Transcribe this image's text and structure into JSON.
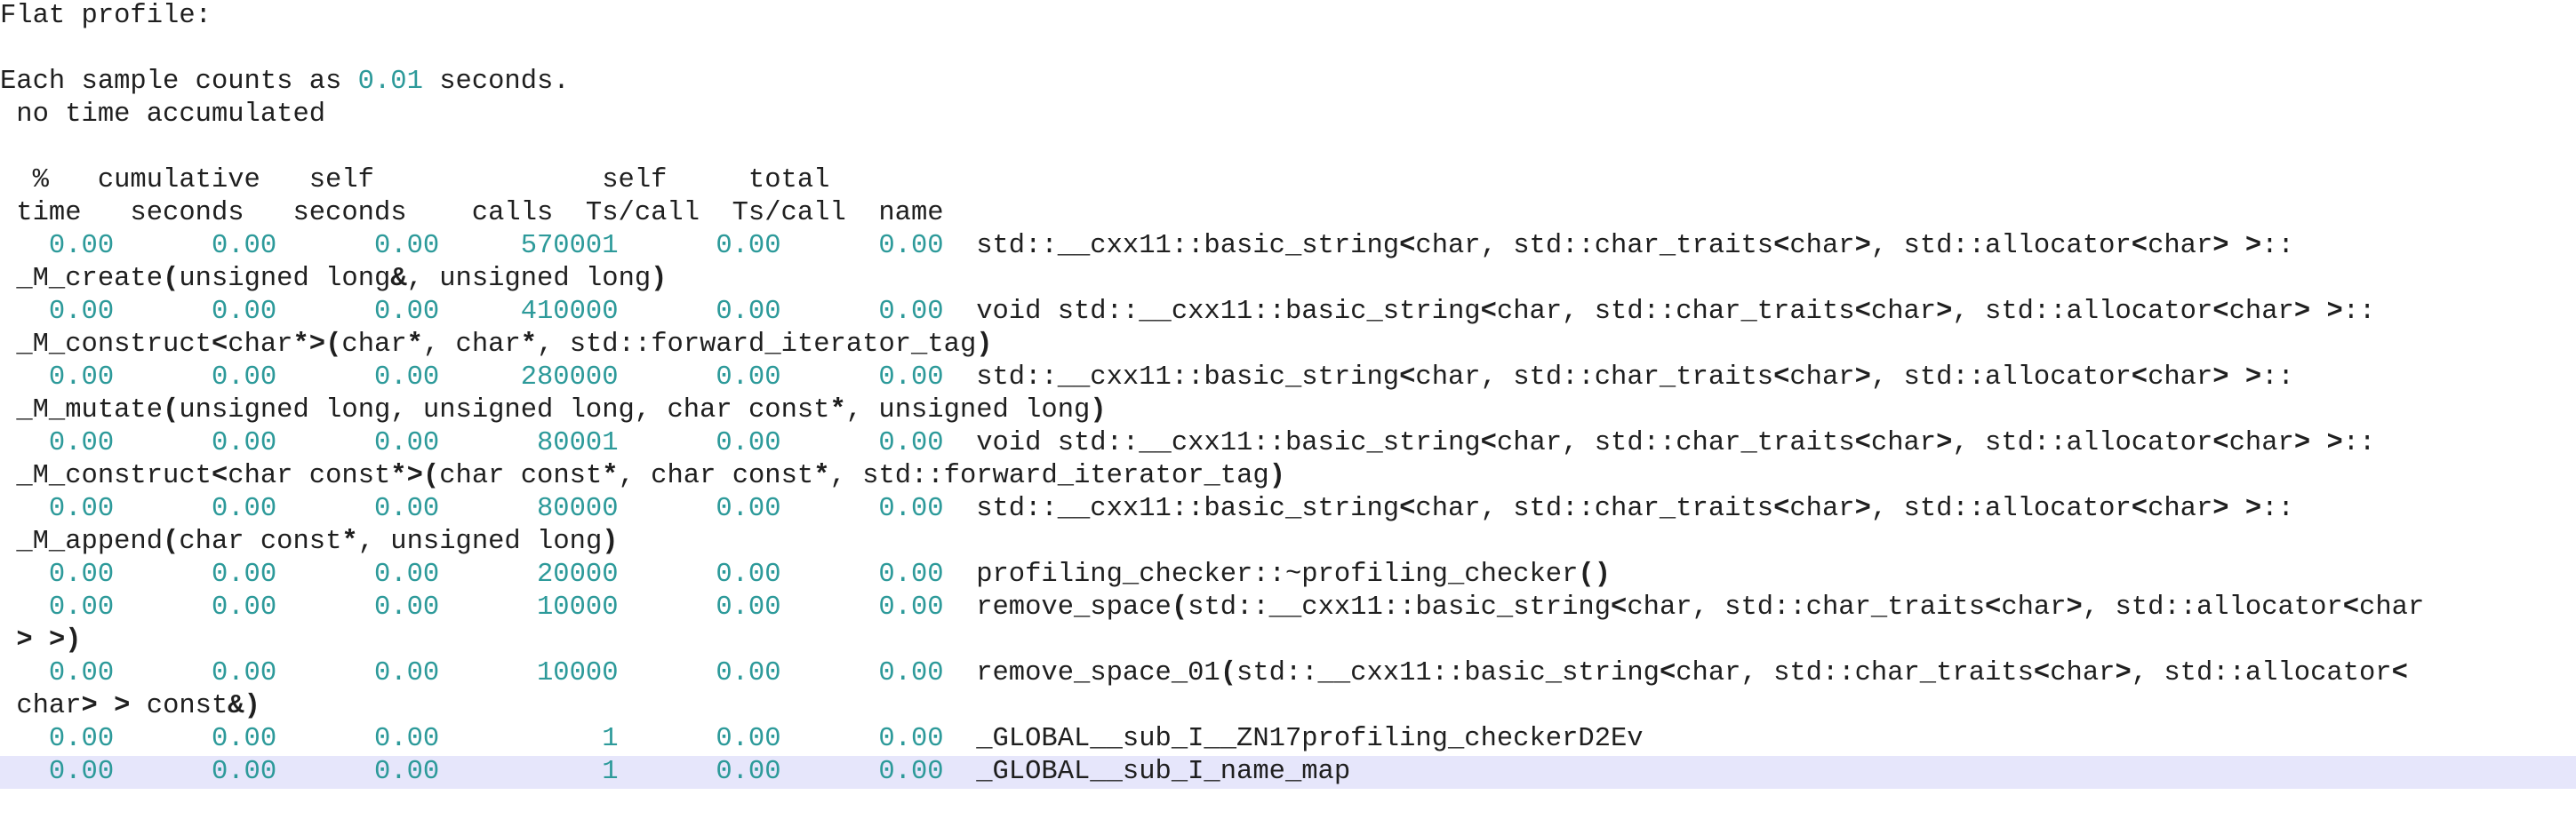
{
  "title": "Flat profile:",
  "sample_prefix": "Each sample counts as ",
  "sample_value": "0.01",
  "sample_suffix": " seconds.",
  "no_time": " no time accumulated",
  "header1": "  %   cumulative   self              self     total           ",
  "header2": " time   seconds   seconds    calls  Ts/call  Ts/call  name    ",
  "colors": {
    "number": "#2d9a9a",
    "text": "#1f1f1f",
    "highlight": "#e6e6fb"
  },
  "rows": [
    {
      "time": "0.00",
      "cumulative": "0.00",
      "self": "0.00",
      "calls": "570001",
      "self_ts": "0.00",
      "total_ts": "0.00",
      "name1": "std::__cxx11::basic_string<char, std::char_traits<char>, std::allocator<char> >::",
      "name2": "_M_create(unsigned long&, unsigned long)"
    },
    {
      "time": "0.00",
      "cumulative": "0.00",
      "self": "0.00",
      "calls": "410000",
      "self_ts": "0.00",
      "total_ts": "0.00",
      "name1": "void std::__cxx11::basic_string<char, std::char_traits<char>, std::allocator<char> >::",
      "name2": "_M_construct<char*>(char*, char*, std::forward_iterator_tag)"
    },
    {
      "time": "0.00",
      "cumulative": "0.00",
      "self": "0.00",
      "calls": "280000",
      "self_ts": "0.00",
      "total_ts": "0.00",
      "name1": "std::__cxx11::basic_string<char, std::char_traits<char>, std::allocator<char> >::",
      "name2": "_M_mutate(unsigned long, unsigned long, char const*, unsigned long)"
    },
    {
      "time": "0.00",
      "cumulative": "0.00",
      "self": "0.00",
      "calls": "80001",
      "self_ts": "0.00",
      "total_ts": "0.00",
      "name1": "void std::__cxx11::basic_string<char, std::char_traits<char>, std::allocator<char> >::",
      "name2": "_M_construct<char const*>(char const*, char const*, std::forward_iterator_tag)"
    },
    {
      "time": "0.00",
      "cumulative": "0.00",
      "self": "0.00",
      "calls": "80000",
      "self_ts": "0.00",
      "total_ts": "0.00",
      "name1": "std::__cxx11::basic_string<char, std::char_traits<char>, std::allocator<char> >::",
      "name2": "_M_append(char const*, unsigned long)"
    },
    {
      "time": "0.00",
      "cumulative": "0.00",
      "self": "0.00",
      "calls": "20000",
      "self_ts": "0.00",
      "total_ts": "0.00",
      "name1": "profiling_checker::~profiling_checker()",
      "name2": ""
    },
    {
      "time": "0.00",
      "cumulative": "0.00",
      "self": "0.00",
      "calls": "10000",
      "self_ts": "0.00",
      "total_ts": "0.00",
      "name1": "remove_space(std::__cxx11::basic_string<char, std::char_traits<char>, std::allocator<char",
      "name2": "> >)"
    },
    {
      "time": "0.00",
      "cumulative": "0.00",
      "self": "0.00",
      "calls": "10000",
      "self_ts": "0.00",
      "total_ts": "0.00",
      "name1": "remove_space_01(std::__cxx11::basic_string<char, std::char_traits<char>, std::allocator<",
      "name2": "char> > const&)"
    },
    {
      "time": "0.00",
      "cumulative": "0.00",
      "self": "0.00",
      "calls": "1",
      "self_ts": "0.00",
      "total_ts": "0.00",
      "name1": "_GLOBAL__sub_I__ZN17profiling_checkerD2Ev",
      "name2": ""
    },
    {
      "time": "0.00",
      "cumulative": "0.00",
      "self": "0.00",
      "calls": "1",
      "self_ts": "0.00",
      "total_ts": "0.00",
      "name1": "_GLOBAL__sub_I_name_map",
      "name2": ""
    }
  ]
}
